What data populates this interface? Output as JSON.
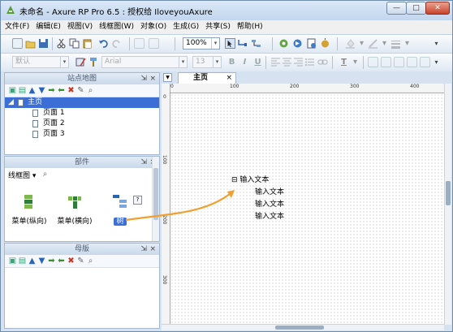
{
  "window": {
    "title": "未命名 - Axure RP Pro 6.5 : 授权给 IloveyouAxure",
    "min_label": "—",
    "max_label": "□",
    "close_label": "✕"
  },
  "menu": [
    "文件(F)",
    "编辑(E)",
    "视图(V)",
    "线框图(W)",
    "对象(O)",
    "生成(G)",
    "共享(S)",
    "帮助(H)"
  ],
  "toolbar": {
    "zoom": "100%",
    "style_default": "默认",
    "font_name": "Arial",
    "font_size": "13",
    "bold": "B",
    "italic": "I",
    "underline": "U",
    "text_color": "T"
  },
  "sitemap": {
    "title": "站点地图",
    "pin": "⇲",
    "close": "×",
    "root": "主页",
    "pages": [
      "页面 1",
      "页面 2",
      "页面 3"
    ]
  },
  "widgets": {
    "title": "部件",
    "pin": "⇲",
    "close": "×",
    "library": "线框图",
    "items": [
      {
        "label": "菜单(纵向)"
      },
      {
        "label": "菜单(横向)"
      },
      {
        "label": "树",
        "highlighted": true
      }
    ]
  },
  "masters": {
    "title": "母版",
    "pin": "⇲",
    "close": "×"
  },
  "canvas": {
    "tab": "主页",
    "tab_close": "×",
    "ruler_h": [
      "0",
      "100",
      "200",
      "300",
      "400"
    ],
    "ruler_v": [
      "0",
      "100",
      "200",
      "300"
    ],
    "tree_widget": {
      "expander": "⊟",
      "root": "输入文本",
      "children": [
        "输入文本",
        "输入文本",
        "输入文本"
      ]
    }
  },
  "colors": {
    "accent": "#3b6fd6",
    "arrow": "#f0a030",
    "chrome": "#d6e2f0"
  }
}
